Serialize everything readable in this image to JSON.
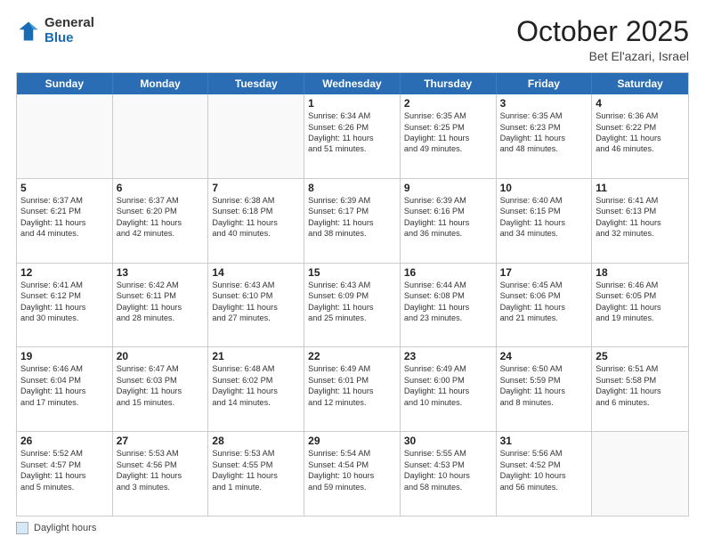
{
  "header": {
    "logo_general": "General",
    "logo_blue": "Blue",
    "month_title": "October 2025",
    "subtitle": "Bet El'azari, Israel"
  },
  "footer": {
    "legend_label": "Daylight hours"
  },
  "calendar": {
    "weekdays": [
      "Sunday",
      "Monday",
      "Tuesday",
      "Wednesday",
      "Thursday",
      "Friday",
      "Saturday"
    ],
    "rows": [
      [
        {
          "day": "",
          "info": ""
        },
        {
          "day": "",
          "info": ""
        },
        {
          "day": "",
          "info": ""
        },
        {
          "day": "1",
          "info": "Sunrise: 6:34 AM\nSunset: 6:26 PM\nDaylight: 11 hours\nand 51 minutes."
        },
        {
          "day": "2",
          "info": "Sunrise: 6:35 AM\nSunset: 6:25 PM\nDaylight: 11 hours\nand 49 minutes."
        },
        {
          "day": "3",
          "info": "Sunrise: 6:35 AM\nSunset: 6:23 PM\nDaylight: 11 hours\nand 48 minutes."
        },
        {
          "day": "4",
          "info": "Sunrise: 6:36 AM\nSunset: 6:22 PM\nDaylight: 11 hours\nand 46 minutes."
        }
      ],
      [
        {
          "day": "5",
          "info": "Sunrise: 6:37 AM\nSunset: 6:21 PM\nDaylight: 11 hours\nand 44 minutes."
        },
        {
          "day": "6",
          "info": "Sunrise: 6:37 AM\nSunset: 6:20 PM\nDaylight: 11 hours\nand 42 minutes."
        },
        {
          "day": "7",
          "info": "Sunrise: 6:38 AM\nSunset: 6:18 PM\nDaylight: 11 hours\nand 40 minutes."
        },
        {
          "day": "8",
          "info": "Sunrise: 6:39 AM\nSunset: 6:17 PM\nDaylight: 11 hours\nand 38 minutes."
        },
        {
          "day": "9",
          "info": "Sunrise: 6:39 AM\nSunset: 6:16 PM\nDaylight: 11 hours\nand 36 minutes."
        },
        {
          "day": "10",
          "info": "Sunrise: 6:40 AM\nSunset: 6:15 PM\nDaylight: 11 hours\nand 34 minutes."
        },
        {
          "day": "11",
          "info": "Sunrise: 6:41 AM\nSunset: 6:13 PM\nDaylight: 11 hours\nand 32 minutes."
        }
      ],
      [
        {
          "day": "12",
          "info": "Sunrise: 6:41 AM\nSunset: 6:12 PM\nDaylight: 11 hours\nand 30 minutes."
        },
        {
          "day": "13",
          "info": "Sunrise: 6:42 AM\nSunset: 6:11 PM\nDaylight: 11 hours\nand 28 minutes."
        },
        {
          "day": "14",
          "info": "Sunrise: 6:43 AM\nSunset: 6:10 PM\nDaylight: 11 hours\nand 27 minutes."
        },
        {
          "day": "15",
          "info": "Sunrise: 6:43 AM\nSunset: 6:09 PM\nDaylight: 11 hours\nand 25 minutes."
        },
        {
          "day": "16",
          "info": "Sunrise: 6:44 AM\nSunset: 6:08 PM\nDaylight: 11 hours\nand 23 minutes."
        },
        {
          "day": "17",
          "info": "Sunrise: 6:45 AM\nSunset: 6:06 PM\nDaylight: 11 hours\nand 21 minutes."
        },
        {
          "day": "18",
          "info": "Sunrise: 6:46 AM\nSunset: 6:05 PM\nDaylight: 11 hours\nand 19 minutes."
        }
      ],
      [
        {
          "day": "19",
          "info": "Sunrise: 6:46 AM\nSunset: 6:04 PM\nDaylight: 11 hours\nand 17 minutes."
        },
        {
          "day": "20",
          "info": "Sunrise: 6:47 AM\nSunset: 6:03 PM\nDaylight: 11 hours\nand 15 minutes."
        },
        {
          "day": "21",
          "info": "Sunrise: 6:48 AM\nSunset: 6:02 PM\nDaylight: 11 hours\nand 14 minutes."
        },
        {
          "day": "22",
          "info": "Sunrise: 6:49 AM\nSunset: 6:01 PM\nDaylight: 11 hours\nand 12 minutes."
        },
        {
          "day": "23",
          "info": "Sunrise: 6:49 AM\nSunset: 6:00 PM\nDaylight: 11 hours\nand 10 minutes."
        },
        {
          "day": "24",
          "info": "Sunrise: 6:50 AM\nSunset: 5:59 PM\nDaylight: 11 hours\nand 8 minutes."
        },
        {
          "day": "25",
          "info": "Sunrise: 6:51 AM\nSunset: 5:58 PM\nDaylight: 11 hours\nand 6 minutes."
        }
      ],
      [
        {
          "day": "26",
          "info": "Sunrise: 5:52 AM\nSunset: 4:57 PM\nDaylight: 11 hours\nand 5 minutes."
        },
        {
          "day": "27",
          "info": "Sunrise: 5:53 AM\nSunset: 4:56 PM\nDaylight: 11 hours\nand 3 minutes."
        },
        {
          "day": "28",
          "info": "Sunrise: 5:53 AM\nSunset: 4:55 PM\nDaylight: 11 hours\nand 1 minute."
        },
        {
          "day": "29",
          "info": "Sunrise: 5:54 AM\nSunset: 4:54 PM\nDaylight: 10 hours\nand 59 minutes."
        },
        {
          "day": "30",
          "info": "Sunrise: 5:55 AM\nSunset: 4:53 PM\nDaylight: 10 hours\nand 58 minutes."
        },
        {
          "day": "31",
          "info": "Sunrise: 5:56 AM\nSunset: 4:52 PM\nDaylight: 10 hours\nand 56 minutes."
        },
        {
          "day": "",
          "info": ""
        }
      ]
    ]
  }
}
